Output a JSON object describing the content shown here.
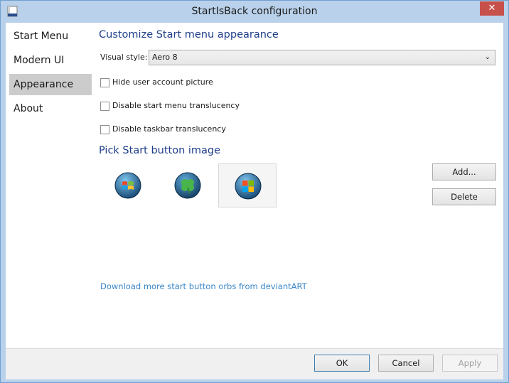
{
  "window": {
    "title": "StartIsBack configuration",
    "close_glyph": "✕"
  },
  "nav": {
    "items": [
      {
        "label": "Start Menu",
        "selected": false
      },
      {
        "label": "Modern UI",
        "selected": false
      },
      {
        "label": "Appearance",
        "selected": true
      },
      {
        "label": "About",
        "selected": false
      }
    ]
  },
  "appearance": {
    "section_title": "Customize Start menu appearance",
    "visual_style_label": "Visual style:",
    "visual_style_value": "Aero 8",
    "checkboxes": [
      {
        "label": "Hide user account picture",
        "checked": false
      },
      {
        "label": "Disable start menu translucency",
        "checked": false
      },
      {
        "label": "Disable taskbar translucency",
        "checked": false
      }
    ],
    "pick_title": "Pick Start button image",
    "orbs": [
      {
        "icon": "windows-7-orb-icon",
        "selected": false
      },
      {
        "icon": "clover-orb-icon",
        "selected": false
      },
      {
        "icon": "windows-8-orb-icon",
        "selected": true
      }
    ],
    "add_label": "Add...",
    "delete_label": "Delete",
    "download_link": "Download more start button orbs from deviantART"
  },
  "footer": {
    "ok_label": "OK",
    "cancel_label": "Cancel",
    "apply_label": "Apply"
  },
  "colors": {
    "accent": "#1f3f8a",
    "link": "#3a86c8",
    "close": "#c7504b",
    "selected_nav": "#cccccc"
  }
}
